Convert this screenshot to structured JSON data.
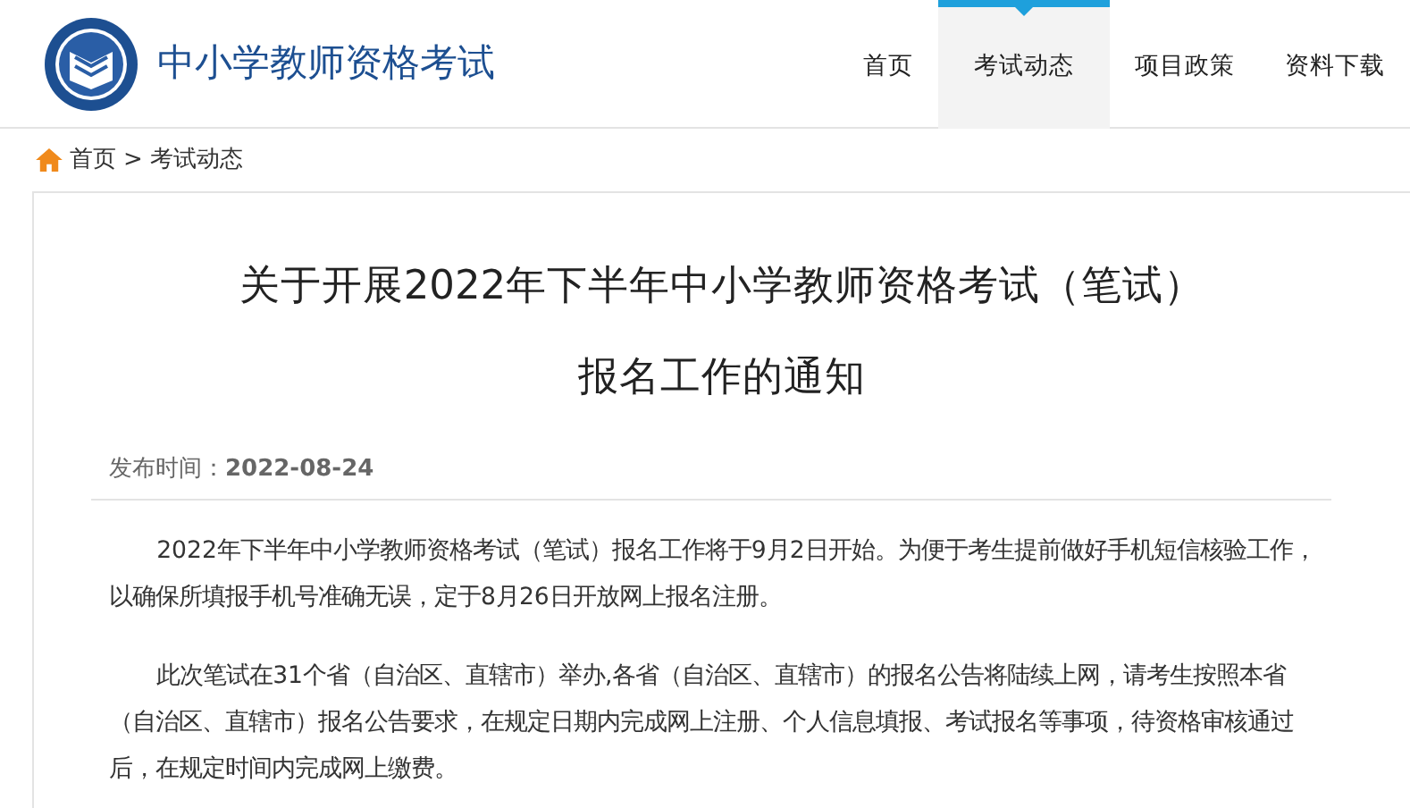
{
  "site": {
    "title": "中小学教师资格考试"
  },
  "nav": [
    {
      "label": "首页",
      "selected": false
    },
    {
      "label": "考试动态",
      "selected": true
    },
    {
      "label": "项目政策",
      "selected": false
    },
    {
      "label": "资料下载",
      "selected": false
    }
  ],
  "breadcrumb": {
    "items": [
      "首页",
      "考试动态"
    ],
    "separator": ">"
  },
  "article": {
    "title_lines": [
      "关于开展2022年下半年中小学教师资格考试（笔试）",
      "报名工作的通知"
    ],
    "meta_label": "发布时间：",
    "meta_date": "2022-08-24",
    "paragraphs": [
      "2022年下半年中小学教师资格考试（笔试）报名工作将于9月2日开始。为便于考生提前做好手机短信核验工作，以确保所填报手机号准确无误，定于8月26日开放网上报名注册。",
      "此次笔试在31个省（自治区、直辖市）举办,各省（自治区、直辖市）的报名公告将陆续上网，请考生按照本省（自治区、直辖市）报名公告要求，在规定日期内完成网上注册、个人信息填报、考试报名等事项，待资格审核通过后，在规定时间内完成网上缴费。"
    ]
  }
}
